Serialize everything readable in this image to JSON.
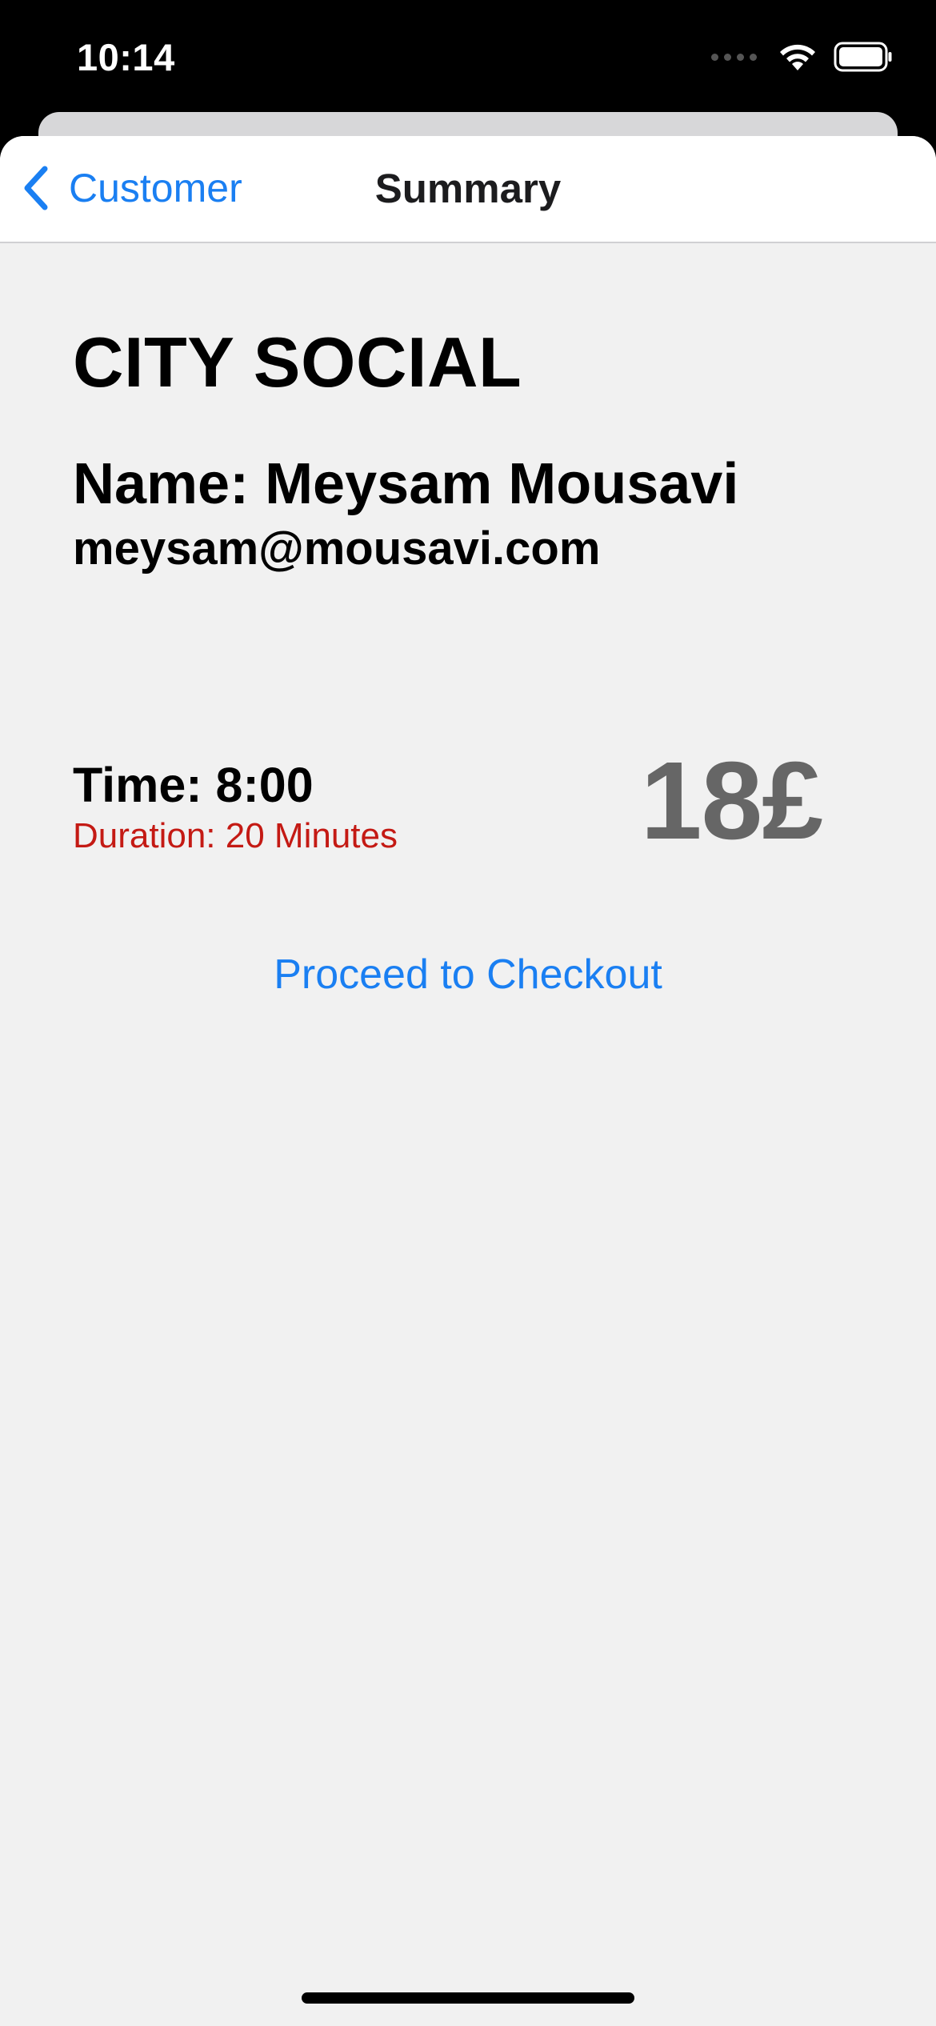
{
  "status_bar": {
    "time": "10:14"
  },
  "nav": {
    "back_label": "Customer",
    "title": "Summary"
  },
  "summary": {
    "venue": "CITY SOCIAL",
    "name": "Name: Meysam Mousavi",
    "email": "meysam@mousavi.com",
    "time": "Time: 8:00",
    "duration": "Duration: 20 Minutes",
    "price": "18£"
  },
  "actions": {
    "checkout_label": "Proceed to Checkout"
  },
  "colors": {
    "accent": "#1a7ff2",
    "duration": "#c41a14",
    "price": "#666666",
    "background": "#f1f1f1"
  },
  "icons": {
    "back": "chevron-left-icon",
    "wifi": "wifi-icon",
    "battery": "battery-icon",
    "signal": "signal-icon"
  }
}
